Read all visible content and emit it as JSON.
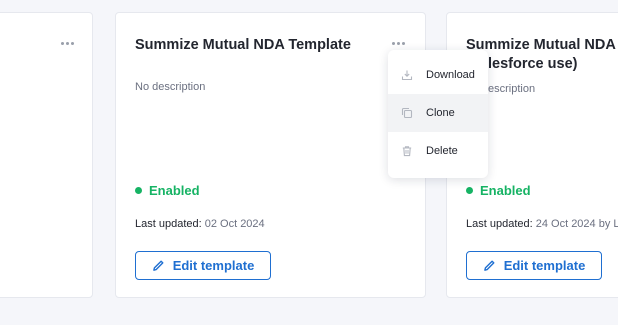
{
  "cards": [
    {
      "title": "",
      "more_icon": "ellipsis-icon"
    },
    {
      "title": "Summize Mutual NDA Template",
      "description": "No description",
      "status": "Enabled",
      "updated_label": "Last updated:",
      "updated_value": "02 Oct 2024",
      "edit_label": "Edit template",
      "more_icon": "ellipsis-icon"
    },
    {
      "title_line1": "Summize Mutual NDA",
      "title_line2": "lesforce use)",
      "description": "escription",
      "status": "Enabled",
      "updated_label": "Last updated:",
      "updated_value": "24 Oct 2024 by L",
      "edit_label": "Edit template"
    }
  ],
  "menu": {
    "items": [
      {
        "label": "Download",
        "icon": "download-icon"
      },
      {
        "label": "Clone",
        "icon": "clone-icon"
      },
      {
        "label": "Delete",
        "icon": "trash-icon"
      }
    ]
  },
  "colors": {
    "accent": "#1f6fd1",
    "enabled": "#16b364",
    "background": "#f5f6fa"
  }
}
